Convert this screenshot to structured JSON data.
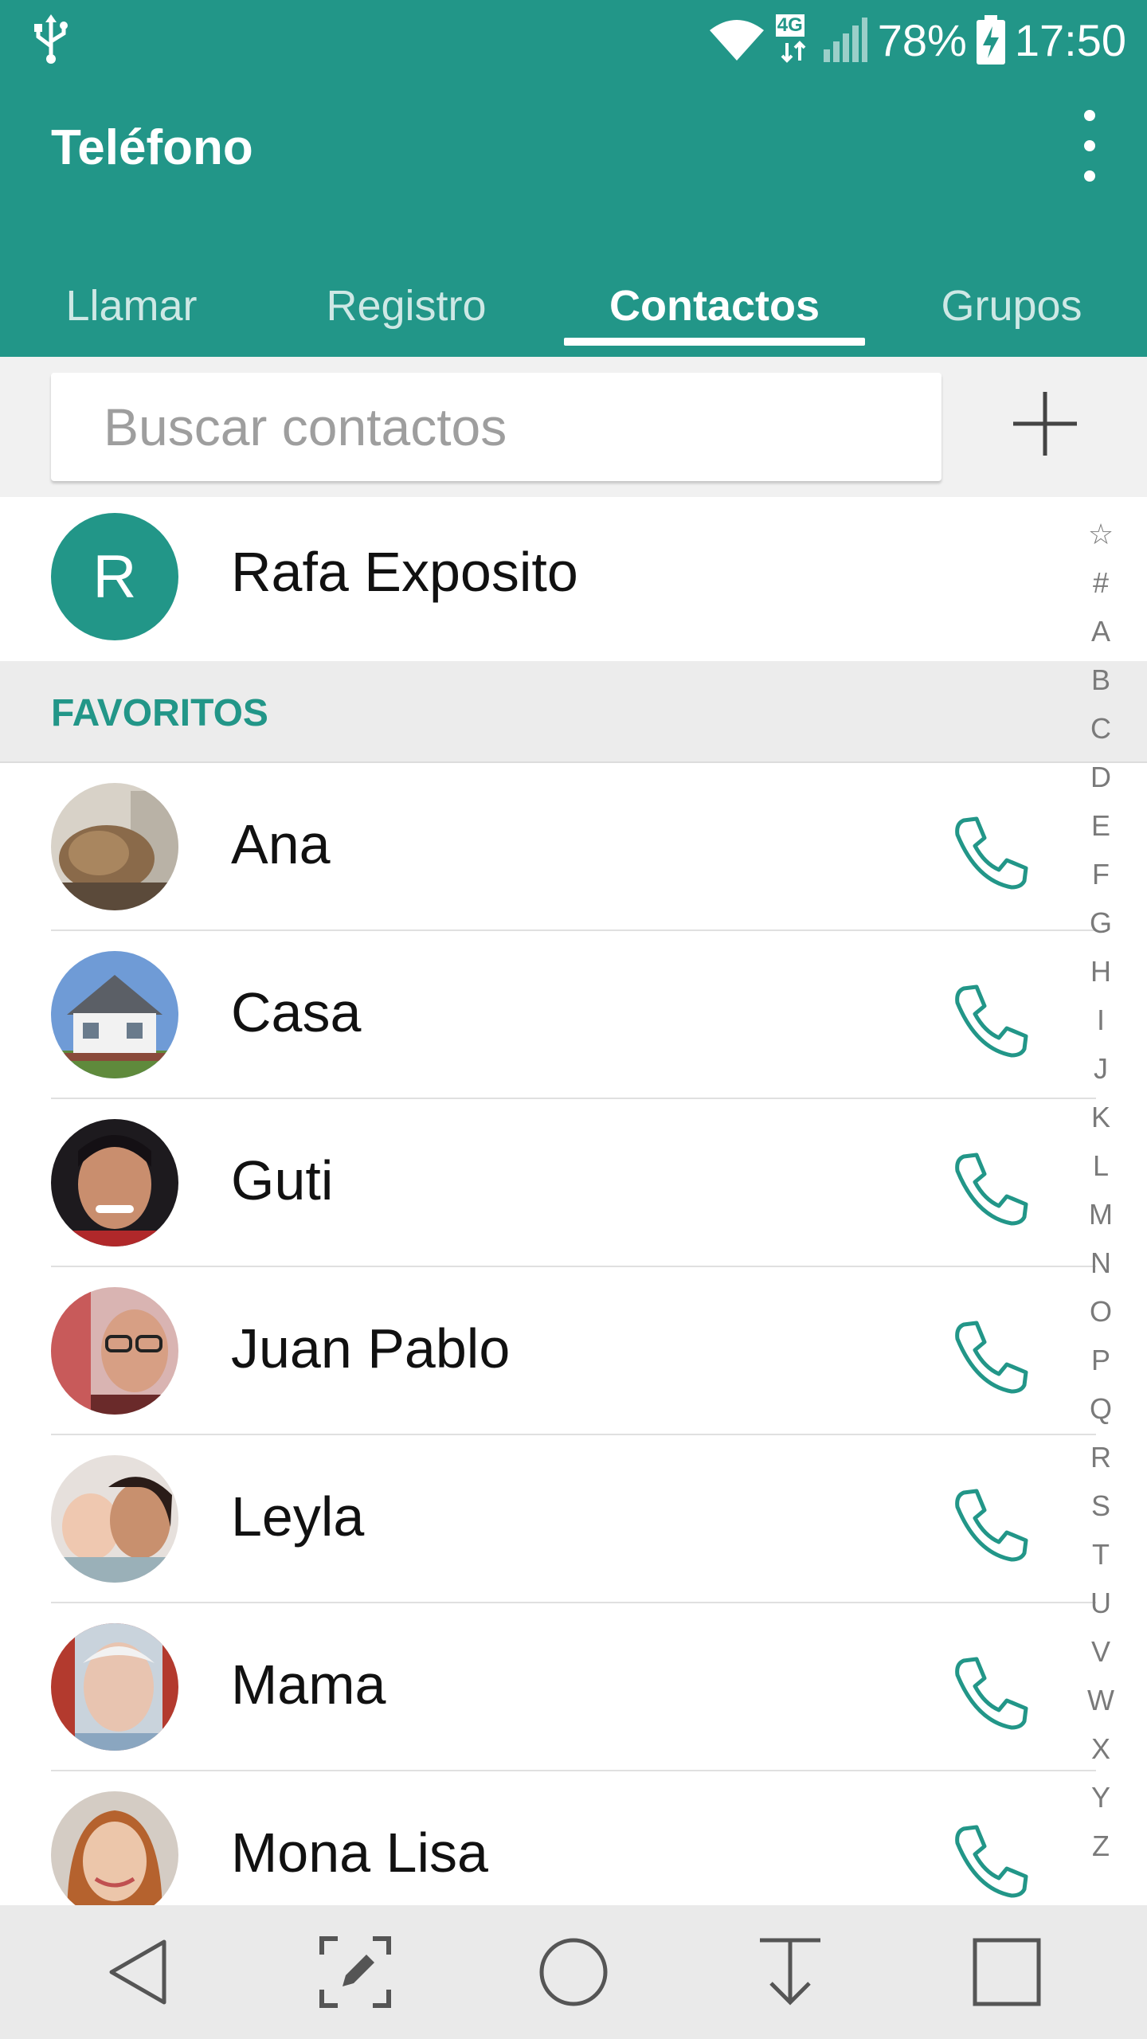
{
  "status_bar": {
    "network": "4G",
    "battery": "78%",
    "time": "17:50",
    "icons": [
      "usb-icon",
      "wifi-icon",
      "signal-icon",
      "battery-charging-icon"
    ]
  },
  "appbar": {
    "title": "Teléfono",
    "menu_icon": "more-vert-icon"
  },
  "tabs": [
    {
      "label": "Llamar",
      "active": false
    },
    {
      "label": "Registro",
      "active": false
    },
    {
      "label": "Contactos",
      "active": true
    },
    {
      "label": "Grupos",
      "active": false
    }
  ],
  "search": {
    "placeholder": "Buscar contactos",
    "value": "",
    "add_icon": "plus-icon"
  },
  "me": {
    "initial": "R",
    "name": "Rafa Exposito"
  },
  "favorites": {
    "header": "FAVORITOS",
    "items": [
      {
        "name": "Ana",
        "photo": "avatar-ana",
        "call_icon": "phone-icon"
      },
      {
        "name": "Casa",
        "photo": "avatar-casa",
        "call_icon": "phone-icon"
      },
      {
        "name": "Guti",
        "photo": "avatar-guti",
        "call_icon": "phone-icon"
      },
      {
        "name": "Juan Pablo",
        "photo": "avatar-juan-pablo",
        "call_icon": "phone-icon"
      },
      {
        "name": "Leyla",
        "photo": "avatar-leyla",
        "call_icon": "phone-icon"
      },
      {
        "name": "Mama",
        "photo": "avatar-mama",
        "call_icon": "phone-icon"
      },
      {
        "name": "Mona Lisa",
        "photo": "avatar-mona-lisa",
        "call_icon": "phone-icon"
      }
    ]
  },
  "alphabet_index": [
    "☆",
    "#",
    "A",
    "B",
    "C",
    "D",
    "E",
    "F",
    "G",
    "H",
    "I",
    "J",
    "K",
    "L",
    "M",
    "N",
    "O",
    "P",
    "Q",
    "R",
    "S",
    "T",
    "U",
    "V",
    "W",
    "X",
    "Y",
    "Z"
  ],
  "nav_bar": [
    "back-icon",
    "capture-plus-icon",
    "home-icon",
    "notification-pull-icon",
    "recents-icon"
  ],
  "colors": {
    "accent": "#229688",
    "section_bg": "#ececec",
    "nav_bg": "#eaeaea"
  }
}
